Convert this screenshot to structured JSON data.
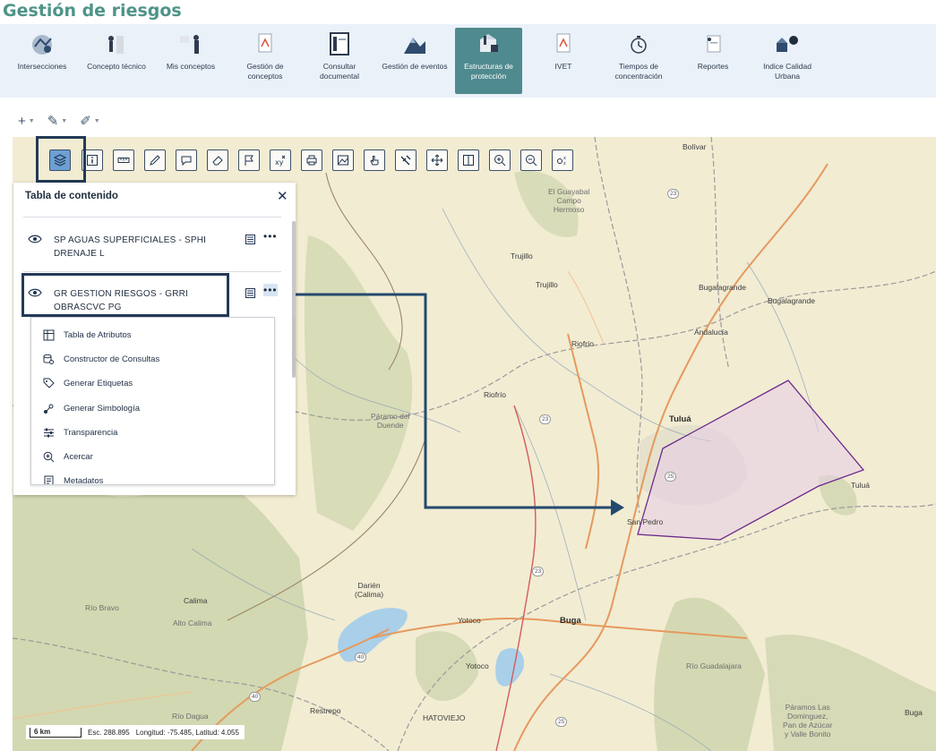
{
  "app": {
    "title": "Gestión de riesgos"
  },
  "modules": [
    {
      "label": "Intersecciones",
      "icon": "intersections-icon",
      "active": false
    },
    {
      "label": "Concepto técnico",
      "icon": "technical-concept-icon",
      "active": false
    },
    {
      "label": "Mis conceptos",
      "icon": "my-concepts-icon",
      "active": false
    },
    {
      "label": "Gestión de\nconceptos",
      "icon": "concept-management-icon",
      "active": false
    },
    {
      "label": "Consultar\ndocumental",
      "icon": "document-query-icon",
      "active": false
    },
    {
      "label": "Gestión de eventos",
      "icon": "event-management-icon",
      "active": false
    },
    {
      "label": "Estructuras de\nprotección",
      "icon": "protection-structures-icon",
      "active": true
    },
    {
      "label": "IVET",
      "icon": "ivet-icon",
      "active": false
    },
    {
      "label": "Tiempos de\nconcentración",
      "icon": "concentration-times-icon",
      "active": false
    },
    {
      "label": "Reportes",
      "icon": "reports-icon",
      "active": false
    },
    {
      "label": "Indice Calidad\nUrbana",
      "icon": "urban-quality-index-icon",
      "active": false
    }
  ],
  "mini_toolbar": [
    {
      "icon": "plus-icon"
    },
    {
      "icon": "pen-add-icon"
    },
    {
      "icon": "pen-edit-icon"
    }
  ],
  "map_toolbar": [
    {
      "icon": "layers-icon",
      "active": true
    },
    {
      "icon": "info-icon"
    },
    {
      "icon": "ruler-icon"
    },
    {
      "icon": "pencil-icon"
    },
    {
      "icon": "comment-icon"
    },
    {
      "icon": "eraser-icon"
    },
    {
      "icon": "flag-icon"
    },
    {
      "icon": "xy-coordinates-icon"
    },
    {
      "icon": "print-icon"
    },
    {
      "icon": "map-image-icon"
    },
    {
      "icon": "hand-pointer-icon"
    },
    {
      "icon": "swipe-icon"
    },
    {
      "icon": "pan-arrows-icon"
    },
    {
      "icon": "split-view-icon"
    },
    {
      "icon": "zoom-in-icon"
    },
    {
      "icon": "zoom-out-icon"
    },
    {
      "icon": "xyz-icon"
    }
  ],
  "toc": {
    "title": "Tabla de contenido",
    "layers": [
      {
        "name": "SP AGUAS SUPERFICIALES - SPHI DRENAJE L"
      },
      {
        "name": "GR GESTION RIESGOS - GRRI OBRASCVC PG"
      }
    ],
    "menu": [
      {
        "label": "Tabla de Atributos",
        "icon": "table-icon"
      },
      {
        "label": "Constructor de Consultas",
        "icon": "query-builder-icon"
      },
      {
        "label": "Generar Etiquetas",
        "icon": "tag-icon"
      },
      {
        "label": "Generar Simbología",
        "icon": "symbology-icon"
      },
      {
        "label": "Transparencia",
        "icon": "sliders-icon"
      },
      {
        "label": "Acercar",
        "icon": "zoom-in-icon"
      },
      {
        "label": "Metadatos",
        "icon": "metadata-icon"
      }
    ]
  },
  "map": {
    "places": [
      "Bolívar",
      "El Guayabal\nCampo\nHermoso",
      "Trujillo",
      "Trujillo",
      "Bugalagrande",
      "Bugalagrande",
      "Andalucía",
      "Riofrío",
      "Riofrío",
      "Tuluá",
      "Tuluá",
      "Páramo del\nDuende",
      "San Pedro",
      "Darién\n(Calima)",
      "Calima",
      "Río Bravo",
      "Alto Calima",
      "Yotoco",
      "Yotoco",
      "Buga",
      "Buga",
      "Río Guadalajara",
      "Río Dagua",
      "Restrepo",
      "HATOVIEJO",
      "Páramos Las\nDominguez,\nPan de Azúcar\ny Valle Bonito",
      "Tuluá"
    ],
    "routes": [
      "23",
      "23",
      "25",
      "23",
      "40",
      "40",
      "25"
    ],
    "scale_label": "6 km",
    "scale_text": "Esc. 288.895",
    "coords_text": "Longitud: -75.485, Latitud: 4.055"
  }
}
